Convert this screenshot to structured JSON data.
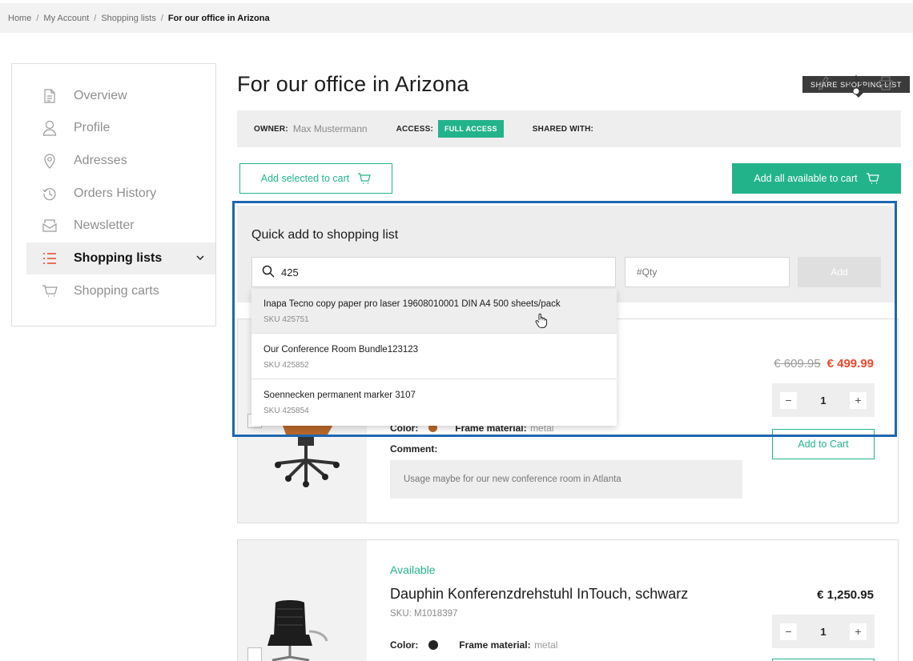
{
  "breadcrumb": {
    "items": [
      "Home",
      "My Account",
      "Shopping lists"
    ],
    "current": "For our office in Arizona"
  },
  "sidebar": {
    "items": [
      {
        "label": "Overview",
        "icon": "document-icon"
      },
      {
        "label": "Profile",
        "icon": "user-icon"
      },
      {
        "label": "Adresses",
        "icon": "location-pin-icon"
      },
      {
        "label": "Orders History",
        "icon": "history-icon"
      },
      {
        "label": "Newsletter",
        "icon": "mail-icon"
      },
      {
        "label": "Shopping lists",
        "icon": "list-icon",
        "active": true
      },
      {
        "label": "Shopping carts",
        "icon": "cart-icon"
      }
    ]
  },
  "page": {
    "title": "For our office in Arizona",
    "tooltip": "SHARE SHOPPING LIST"
  },
  "info": {
    "owner_label": "OWNER:",
    "owner_value": "Max Mustermann",
    "access_label": "ACCESS:",
    "access_value": "FULL ACCESS",
    "shared_label": "SHARED WITH:"
  },
  "actions": {
    "add_selected": "Add selected to cart",
    "add_all": "Add all available to cart"
  },
  "quick_add": {
    "title": "Quick add to shopping list",
    "search_value": "425",
    "qty_placeholder": "#Qty",
    "add_label": "Add",
    "results": [
      {
        "name": "Inapa Tecno copy paper pro laser 19608010001 DIN A4 500 sheets/pack",
        "sku": "SKU 425751"
      },
      {
        "name": "Our Conference Room Bundle123123",
        "sku": "SKU 425852"
      },
      {
        "name": "Soennecken permanent marker 3107",
        "sku": "SKU 425854"
      }
    ]
  },
  "products": [
    {
      "price_old": "€ 609.95",
      "price_new": "€ 499.99",
      "qty": "1",
      "add_to_cart": "Add to Cart",
      "comment_label": "Comment:",
      "comment": "Usage maybe for our new conference room in Atlanta",
      "partial_attr_text": "Color:",
      "partial_frame_text": "Frame material:",
      "partial_frame_value": "metal"
    },
    {
      "availability": "Available",
      "name": "Dauphin Konferenzdrehstuhl InTouch, schwarz",
      "sku": "SKU: M1018397",
      "price": "€ 1,250.95",
      "qty": "1",
      "color_label": "Color:",
      "frame_label": "Frame material:",
      "frame_value": "metal"
    }
  ],
  "colors": {
    "accent": "#23b38b",
    "sale": "#e8472c",
    "highlight_frame": "#1e67b0"
  }
}
